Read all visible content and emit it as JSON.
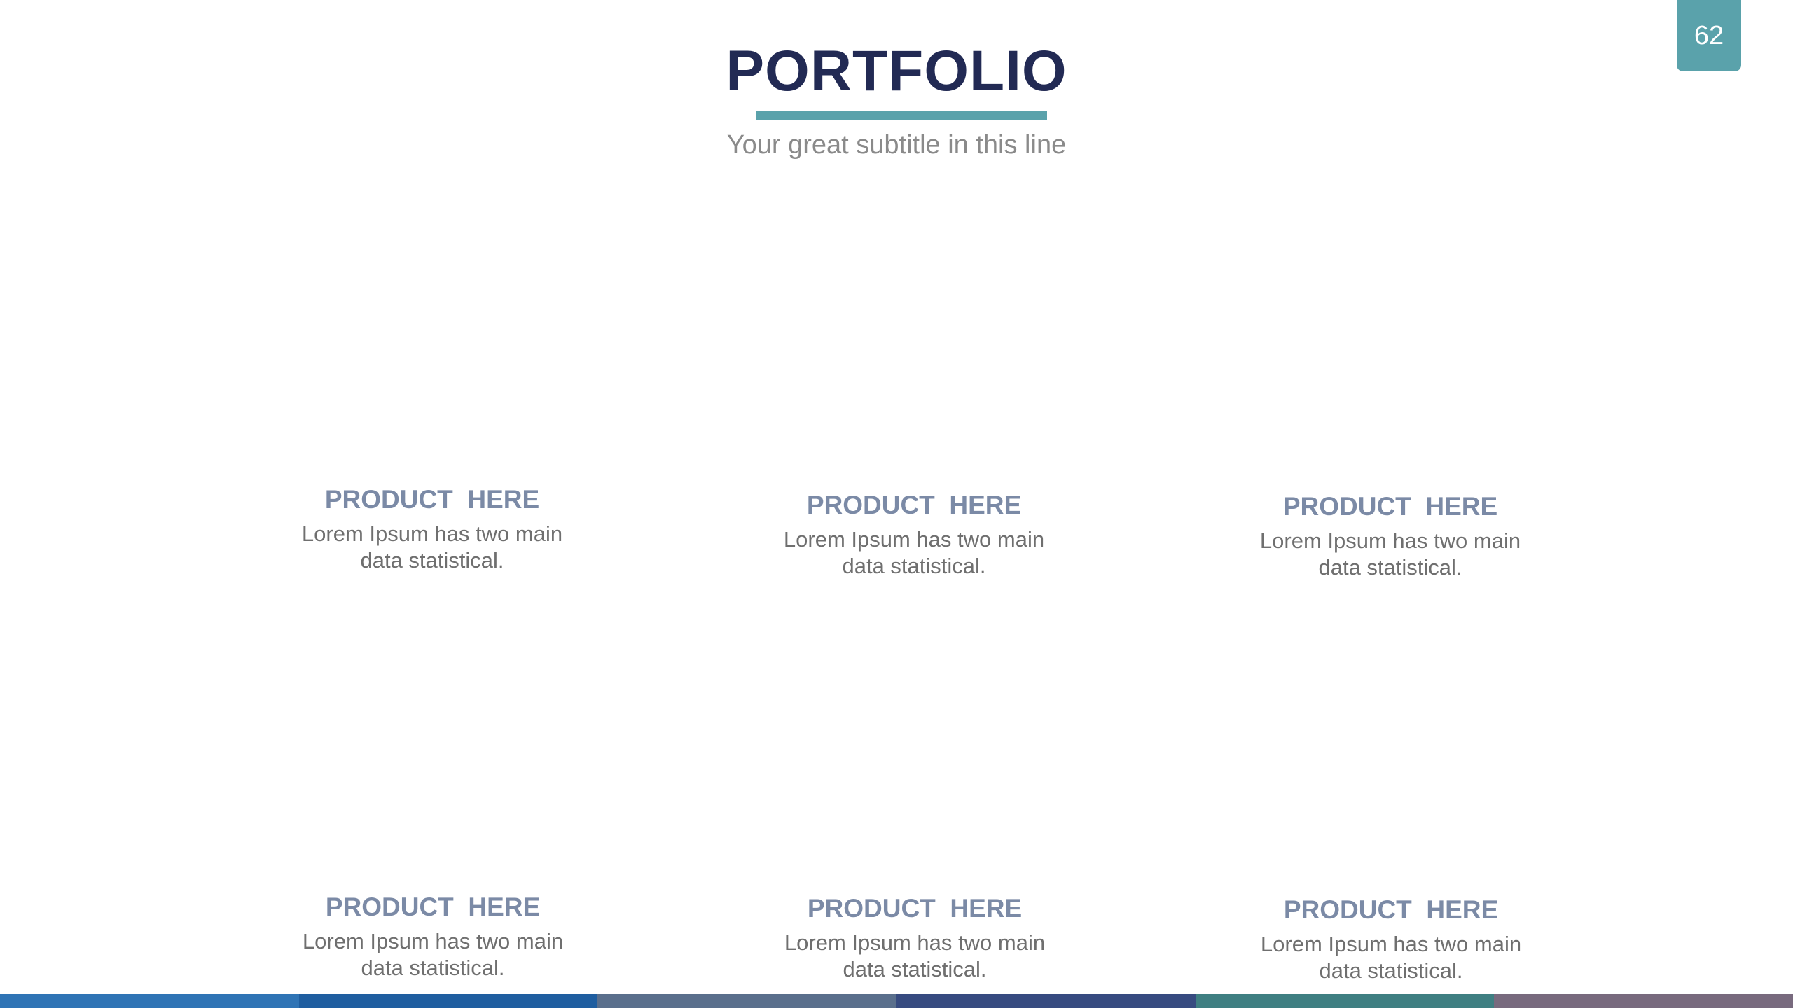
{
  "page_number": "62",
  "title": "PORTFOLIO",
  "subtitle": "Your great subtitle in this line",
  "colors": {
    "accent": "#5aa2ab",
    "title": "#222a54",
    "product_title": "#7b8aa6"
  },
  "products": [
    {
      "title": "PRODUCT  HERE",
      "desc": "Lorem Ipsum has two main\ndata statistical."
    },
    {
      "title": "PRODUCT  HERE",
      "desc": "Lorem Ipsum has two main\ndata statistical."
    },
    {
      "title": "PRODUCT  HERE",
      "desc": "Lorem Ipsum has two main\ndata statistical."
    },
    {
      "title": "PRODUCT  HERE",
      "desc": "Lorem Ipsum has two main\ndata statistical."
    },
    {
      "title": "PRODUCT  HERE",
      "desc": "Lorem Ipsum has two main\ndata statistical."
    },
    {
      "title": "PRODUCT  HERE",
      "desc": "Lorem Ipsum has two main\ndata statistical."
    }
  ],
  "footer_colors": [
    "#2f74b5",
    "#1f5ea0",
    "#5a6f8c",
    "#374b80",
    "#3f7f82",
    "#786a7e"
  ]
}
